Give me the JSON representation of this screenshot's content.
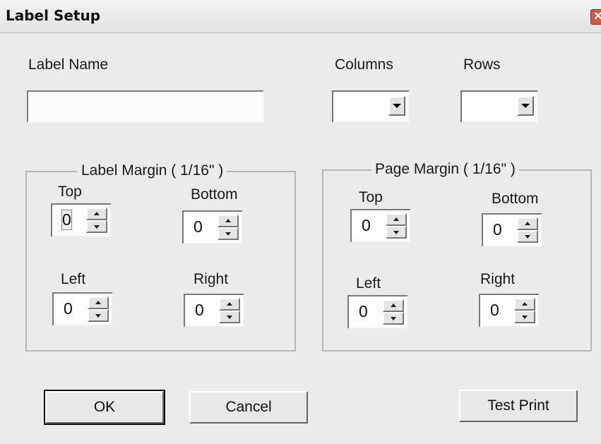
{
  "window": {
    "title": "Label Setup",
    "close_glyph": "✕"
  },
  "label_name": {
    "label": "Label Name",
    "value": ""
  },
  "columns": {
    "label": "Columns",
    "value": ""
  },
  "rows": {
    "label": "Rows",
    "value": ""
  },
  "label_margin": {
    "title": "Label Margin ( 1/16\" )",
    "top": {
      "label": "Top",
      "value": "0"
    },
    "bottom": {
      "label": "Bottom",
      "value": "0"
    },
    "left": {
      "label": "Left",
      "value": "0"
    },
    "right": {
      "label": "Right",
      "value": "0"
    }
  },
  "page_margin": {
    "title": "Page Margin  ( 1/16\" )",
    "top": {
      "label": "Top",
      "value": "0"
    },
    "bottom": {
      "label": "Bottom",
      "value": "0"
    },
    "left": {
      "label": "Left",
      "value": "0"
    },
    "right": {
      "label": "Right",
      "value": "0"
    }
  },
  "buttons": {
    "ok": "OK",
    "cancel": "Cancel",
    "test_print": "Test Print"
  },
  "icons": {
    "close": "close-icon",
    "dropdown": "chevron-down-icon",
    "spin_up": "arrow-up-icon",
    "spin_down": "arrow-down-icon"
  }
}
